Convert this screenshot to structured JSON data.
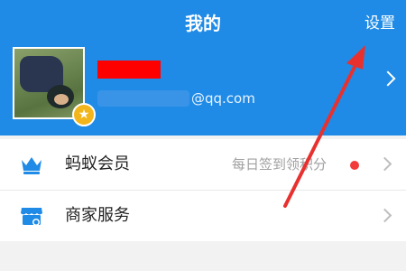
{
  "header": {
    "title": "我的",
    "settings_label": "设置"
  },
  "profile": {
    "email_suffix": "@qq.com",
    "badge_icon": "star-icon"
  },
  "menu": [
    {
      "label": "蚂蚁会员",
      "hint": "每日签到领积分",
      "icon": "crown-icon",
      "has_red_dot": true
    },
    {
      "label": "商家服务",
      "icon": "store-icon"
    }
  ],
  "colors": {
    "header_bg": "#1f8be6",
    "accent": "#1f8be6",
    "red_dot": "#f23b3b",
    "annotation_arrow": "#e8312f"
  }
}
